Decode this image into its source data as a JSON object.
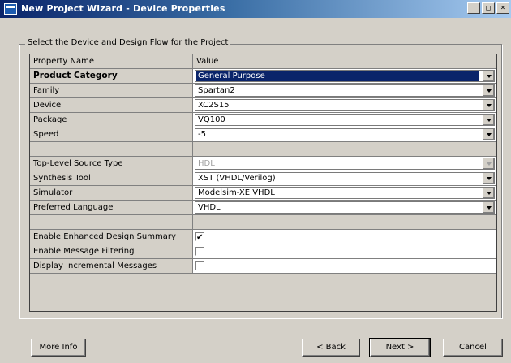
{
  "window": {
    "title": "New Project Wizard - Device Properties",
    "minimize": "_",
    "maximize": "□",
    "close": "×"
  },
  "group": {
    "label": "Select the Device and Design Flow for the Project"
  },
  "grid": {
    "header": {
      "name": "Property Name",
      "value": "Value"
    },
    "rows": [
      {
        "name": "Product Category",
        "value": "General Purpose",
        "kind": "combo",
        "bold": true,
        "selected": true
      },
      {
        "name": "Family",
        "value": "Spartan2",
        "kind": "combo"
      },
      {
        "name": "Device",
        "value": "XC2S15",
        "kind": "combo"
      },
      {
        "name": "Package",
        "value": "VQ100",
        "kind": "combo"
      },
      {
        "name": "Speed",
        "value": "-5",
        "kind": "combo"
      },
      {
        "name": "",
        "value": "",
        "kind": "blank"
      },
      {
        "name": "Top-Level Source Type",
        "value": "HDL",
        "kind": "combo",
        "disabled": true
      },
      {
        "name": "Synthesis Tool",
        "value": "XST (VHDL/Verilog)",
        "kind": "combo"
      },
      {
        "name": "Simulator",
        "value": "Modelsim-XE VHDL",
        "kind": "combo"
      },
      {
        "name": "Preferred Language",
        "value": "VHDL",
        "kind": "combo"
      },
      {
        "name": "",
        "value": "",
        "kind": "blank"
      },
      {
        "name": "Enable Enhanced Design Summary",
        "value": true,
        "kind": "check"
      },
      {
        "name": "Enable Message Filtering",
        "value": false,
        "kind": "check"
      },
      {
        "name": "Display Incremental Messages",
        "value": false,
        "kind": "check"
      }
    ]
  },
  "buttons": {
    "more_info": "More Info",
    "back": "< Back",
    "next": "Next >",
    "cancel": "Cancel"
  }
}
